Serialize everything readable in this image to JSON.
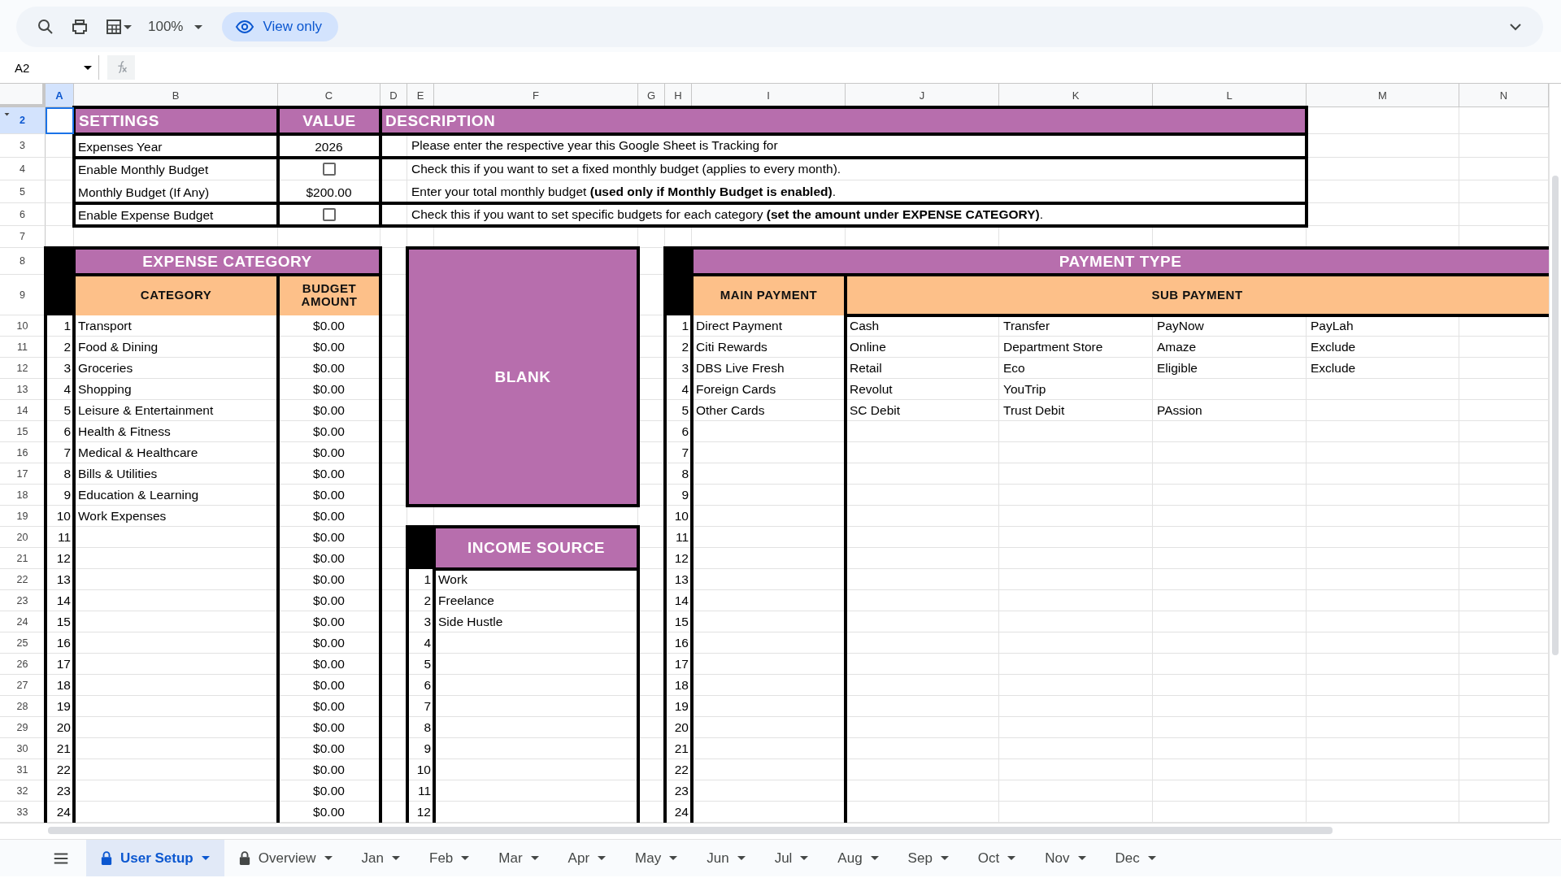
{
  "toolbar": {
    "zoom": "100%",
    "mode": "View only"
  },
  "formula_bar": {
    "cell_ref": "A2"
  },
  "columns": [
    {
      "label": "A",
      "selected": true
    },
    {
      "label": "B",
      "selected": false
    },
    {
      "label": "C",
      "selected": false
    },
    {
      "label": "D",
      "selected": false
    },
    {
      "label": "E",
      "selected": false
    },
    {
      "label": "F",
      "selected": false
    },
    {
      "label": "G",
      "selected": false
    },
    {
      "label": "H",
      "selected": false
    },
    {
      "label": "I",
      "selected": false
    },
    {
      "label": "J",
      "selected": false
    },
    {
      "label": "K",
      "selected": false
    },
    {
      "label": "L",
      "selected": false
    },
    {
      "label": "M",
      "selected": false
    },
    {
      "label": "N",
      "selected": false
    }
  ],
  "rows": [
    {
      "label": "2",
      "selected": true
    },
    {
      "label": "3",
      "selected": false
    },
    {
      "label": "4",
      "selected": false
    },
    {
      "label": "5",
      "selected": false
    },
    {
      "label": "6",
      "selected": false
    },
    {
      "label": "7",
      "selected": false
    },
    {
      "label": "8",
      "selected": false
    },
    {
      "label": "9",
      "selected": false
    },
    {
      "label": "10",
      "selected": false
    },
    {
      "label": "11",
      "selected": false
    },
    {
      "label": "12",
      "selected": false
    },
    {
      "label": "13",
      "selected": false
    },
    {
      "label": "14",
      "selected": false
    },
    {
      "label": "15",
      "selected": false
    },
    {
      "label": "16",
      "selected": false
    },
    {
      "label": "17",
      "selected": false
    },
    {
      "label": "18",
      "selected": false
    },
    {
      "label": "19",
      "selected": false
    },
    {
      "label": "20",
      "selected": false
    },
    {
      "label": "21",
      "selected": false
    },
    {
      "label": "22",
      "selected": false
    },
    {
      "label": "23",
      "selected": false
    },
    {
      "label": "24",
      "selected": false
    },
    {
      "label": "25",
      "selected": false
    },
    {
      "label": "26",
      "selected": false
    },
    {
      "label": "27",
      "selected": false
    },
    {
      "label": "28",
      "selected": false
    },
    {
      "label": "29",
      "selected": false
    },
    {
      "label": "30",
      "selected": false
    },
    {
      "label": "31",
      "selected": false
    },
    {
      "label": "32",
      "selected": false
    },
    {
      "label": "33",
      "selected": false
    }
  ],
  "settings": {
    "headers": [
      "SETTINGS",
      "VALUE",
      "DESCRIPTION"
    ],
    "rows": [
      {
        "kind": "text",
        "label": "Expenses Year",
        "value": "2026",
        "description": "Please enter the respective year this Google Sheet is Tracking for"
      },
      {
        "kind": "checkbox",
        "label": "Enable Monthly Budget",
        "checked": false,
        "description": "Check this if you want to set a fixed monthly budget (applies to every month)."
      },
      {
        "kind": "text",
        "label": "Monthly Budget (If Any)",
        "value": "$200.00",
        "description": "Enter your total monthly budget **(used only if Monthly Budget is enabled)**."
      },
      {
        "kind": "checkbox",
        "label": "Enable Expense Budget",
        "checked": false,
        "description": "Check this if you want to set specific budgets for each category **(set the amount under EXPENSE CATEGORY)**."
      }
    ]
  },
  "expense_category": {
    "title": "EXPENSE CATEGORY",
    "headers": [
      "CATEGORY",
      "BUDGET AMOUNT"
    ],
    "rows": [
      {
        "number": "1",
        "category": "Transport",
        "amount": "$0.00"
      },
      {
        "number": "2",
        "category": "Food & Dining",
        "amount": "$0.00"
      },
      {
        "number": "3",
        "category": "Groceries",
        "amount": "$0.00"
      },
      {
        "number": "4",
        "category": "Shopping",
        "amount": "$0.00"
      },
      {
        "number": "5",
        "category": "Leisure & Entertainment",
        "amount": "$0.00"
      },
      {
        "number": "6",
        "category": "Health & Fitness",
        "amount": "$0.00"
      },
      {
        "number": "7",
        "category": "Medical & Healthcare",
        "amount": "$0.00"
      },
      {
        "number": "8",
        "category": "Bills & Utilities",
        "amount": "$0.00"
      },
      {
        "number": "9",
        "category": "Education & Learning",
        "amount": "$0.00"
      },
      {
        "number": "10",
        "category": "Work Expenses",
        "amount": "$0.00"
      },
      {
        "number": "11",
        "amount": "$0.00"
      },
      {
        "number": "12",
        "amount": "$0.00"
      },
      {
        "number": "13",
        "amount": "$0.00"
      },
      {
        "number": "14",
        "amount": "$0.00"
      },
      {
        "number": "15",
        "amount": "$0.00"
      },
      {
        "number": "16",
        "amount": "$0.00"
      },
      {
        "number": "17",
        "amount": "$0.00"
      },
      {
        "number": "18",
        "amount": "$0.00"
      },
      {
        "number": "19",
        "amount": "$0.00"
      },
      {
        "number": "20",
        "amount": "$0.00"
      },
      {
        "number": "21",
        "amount": "$0.00"
      },
      {
        "number": "22",
        "amount": "$0.00"
      },
      {
        "number": "23",
        "amount": "$0.00"
      },
      {
        "number": "24",
        "amount": "$0.00"
      }
    ]
  },
  "blank_panel": {
    "label": "BLANK"
  },
  "income_source": {
    "title": "INCOME SOURCE",
    "rows": [
      {
        "number": "1",
        "source": "Work"
      },
      {
        "number": "2",
        "source": "Freelance"
      },
      {
        "number": "3",
        "source": "Side Hustle"
      },
      {
        "number": "4"
      },
      {
        "number": "5"
      },
      {
        "number": "6"
      },
      {
        "number": "7"
      },
      {
        "number": "8"
      },
      {
        "number": "9"
      },
      {
        "number": "10"
      },
      {
        "number": "11"
      },
      {
        "number": "12"
      }
    ]
  },
  "payment_type": {
    "title": "PAYMENT TYPE",
    "headers": [
      "MAIN PAYMENT",
      "SUB PAYMENT"
    ],
    "rows": [
      {
        "number": "1",
        "main": "Direct Payment",
        "sub": [
          "Cash",
          "Transfer",
          "PayNow",
          "PayLah"
        ]
      },
      {
        "number": "2",
        "main": "Citi Rewards",
        "sub": [
          "Online",
          "Department Store",
          "Amaze",
          "Exclude"
        ]
      },
      {
        "number": "3",
        "main": "DBS Live Fresh",
        "sub": [
          "Retail",
          "Eco",
          "Eligible",
          "Exclude"
        ]
      },
      {
        "number": "4",
        "main": "Foreign Cards",
        "sub": [
          "Revolut",
          "YouTrip"
        ]
      },
      {
        "number": "5",
        "main": "Other Cards",
        "sub": [
          "SC Debit",
          "Trust Debit",
          "PAssion"
        ]
      },
      {
        "number": "6"
      },
      {
        "number": "7"
      },
      {
        "number": "8"
      },
      {
        "number": "9"
      },
      {
        "number": "10"
      },
      {
        "number": "11"
      },
      {
        "number": "12"
      },
      {
        "number": "13"
      },
      {
        "number": "14"
      },
      {
        "number": "15"
      },
      {
        "number": "16"
      },
      {
        "number": "17"
      },
      {
        "number": "18"
      },
      {
        "number": "19"
      },
      {
        "number": "20"
      },
      {
        "number": "21"
      },
      {
        "number": "22"
      },
      {
        "number": "23"
      },
      {
        "number": "24"
      }
    ]
  },
  "sheet_tabs": [
    {
      "label": "User Setup",
      "selected": true,
      "locked": true
    },
    {
      "label": "Overview",
      "selected": false,
      "locked": true
    },
    {
      "label": "Jan",
      "selected": false,
      "locked": false
    },
    {
      "label": "Feb",
      "selected": false,
      "locked": false
    },
    {
      "label": "Mar",
      "selected": false,
      "locked": false
    },
    {
      "label": "Apr",
      "selected": false,
      "locked": false
    },
    {
      "label": "May",
      "selected": false,
      "locked": false
    },
    {
      "label": "Jun",
      "selected": false,
      "locked": false
    },
    {
      "label": "Jul",
      "selected": false,
      "locked": false
    },
    {
      "label": "Aug",
      "selected": false,
      "locked": false
    },
    {
      "label": "Sep",
      "selected": false,
      "locked": false
    },
    {
      "label": "Oct",
      "selected": false,
      "locked": false
    },
    {
      "label": "Nov",
      "selected": false,
      "locked": false
    },
    {
      "label": "Dec",
      "selected": false,
      "locked": false
    }
  ]
}
